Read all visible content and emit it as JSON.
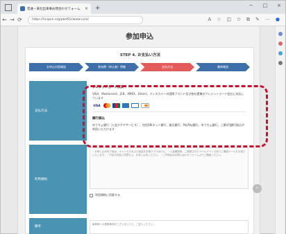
{
  "browser": {
    "tab_title": "普通・来社出来事お問合わせフォーム",
    "tab_close": "×",
    "new_tab": "+",
    "url": "https://hcapm.org/pbsf02/www.com/",
    "window_controls": [
      "−",
      "□",
      "×"
    ]
  },
  "page": {
    "title": "参加申込",
    "step_title": "STEP 4. お支払い方法",
    "steps": [
      {
        "label": "お申込内容確認",
        "active": false
      },
      {
        "label": "参加費（申込者）明細",
        "active": false
      },
      {
        "label": "支払方法",
        "active": true
      },
      {
        "label": "最終確認",
        "active": false
      }
    ],
    "payment": {
      "label": "支払方法",
      "credit_heading": "クレジットカード決済",
      "credit_text": "VISA、Mastercard、JCB、AMEX、Diners、ディスカバーの国際ブランド及び各社提携のクレジットカード会社に対応しています",
      "card_logos": [
        "VISA",
        "Mastercard",
        "JCB",
        "AMEX",
        "Diners",
        "Discover"
      ],
      "bank_heading": "銀行振込",
      "bank_text": "ゆうちょ銀行（入金ホケヤサービス）、住信SBIネット銀行、楽天銀行、PayPay銀行、ゆうちょ銀行、三菱UFJ銀行振込が利用いただけます"
    },
    "notes": {
      "label": "利用規約",
      "text": "・お申し込み完了後は、キャンセルおよび返金をお受けできません。・入金確認後、ご登録されたメールアドレス宛てに確認メールをお送りいたします。・下記の内容に同意の上、お申し込みください。・ご不明点はお問い合わせフォームよりご連絡ください。",
      "checkbox_label": "利用規約に同意する"
    },
    "remarks": {
      "label": "備考",
      "placeholder": "事務局への連絡事項がございましたら、ご記入ください。"
    }
  },
  "colors": {
    "step_active": "#e35b5b",
    "step_default": "#3e6fa8",
    "label_bg": "#4b93b3",
    "highlight": "#c8102e"
  }
}
